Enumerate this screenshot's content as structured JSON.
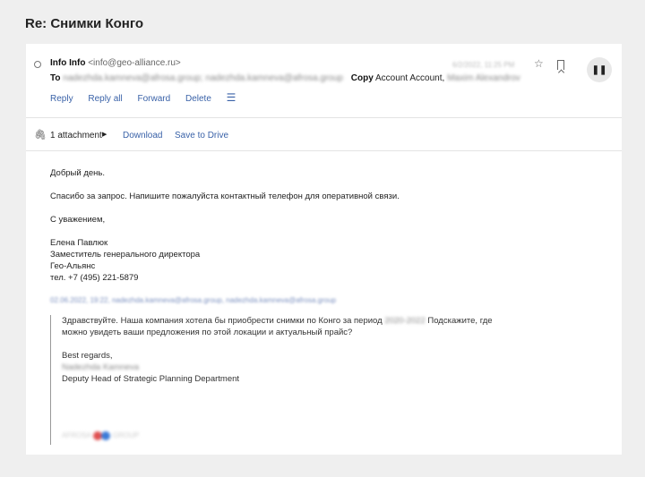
{
  "subject": "Re: Снимки Конго",
  "message": {
    "from_name": "Info Info",
    "from_addr": "<info@geo-alliance.ru>",
    "date_blurred": "6/2/2022, 11:25 PM",
    "to_label": "To",
    "to_blurred": "nadezhda.kamneva@afrosa.group; nadezhda.kamneva@afrosa.group",
    "copy_label": "Copy",
    "copy_value": "Account Account,",
    "copy_blurred": "Maxim Alexandrov"
  },
  "actions": {
    "reply": "Reply",
    "reply_all": "Reply all",
    "forward": "Forward",
    "delete": "Delete",
    "menu_icon": "☰"
  },
  "attachments": {
    "count_label": "1 attachment",
    "download": "Download",
    "save_to_drive": "Save to Drive"
  },
  "body": {
    "greeting": "Добрый день.",
    "line1": "Спасибо за запрос. Напишите пожалуйста контактный телефон для оперативной связи.",
    "regards": "С уважением,",
    "sig_name": "Елена Павлюк",
    "sig_title": "Заместитель генерального директора",
    "sig_company": "Гео-Альянс",
    "sig_phone": "тел. +7 (495) 221-5879"
  },
  "quote": {
    "header_blurred": "02.06.2022, 19:22, nadezhda.kamneva@afrosa.group, nadezhda.kamneva@afrosa.group",
    "line1_a": "Здравствуйте. Наша компания хотела бы приобрести снимки по Конго за период",
    "line1_blurred": "2020-2022",
    "line1_b": "Подскажите, где",
    "line2": "можно увидеть ваши предложения по этой локации и актуальный прайс?",
    "best_regards": "Best regards,",
    "name_blurred": "Nadezhda Kamneva",
    "role": "Deputy Head of Strategic Planning Department",
    "logo_left_blurred": "AFROSA",
    "logo_right_blurred": "GROUP"
  },
  "colors": {
    "link": "#3a62a8",
    "logo_red": "#e05050",
    "logo_blue": "#3b7bd8"
  }
}
